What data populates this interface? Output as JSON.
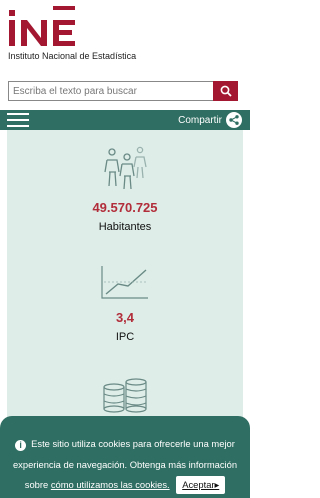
{
  "header": {
    "logo_text": "Instituto Nacional de Estadística",
    "brand_color": "#a31830"
  },
  "search": {
    "placeholder": "Escriba el texto para buscar",
    "icon": "search-icon"
  },
  "nav": {
    "menu_icon": "hamburger-icon",
    "share_label": "Compartir",
    "share_icon": "share-icon",
    "bar_color": "#2f6e62"
  },
  "stats": [
    {
      "icon": "people-icon",
      "value": "49.570.725",
      "label": "Habitantes"
    },
    {
      "icon": "line-chart-icon",
      "value": "3,4",
      "label": "IPC"
    },
    {
      "icon": "coins-icon"
    }
  ],
  "cookie": {
    "line1": "Este sitio utiliza cookies para ofrecerle una mejor",
    "line2": "experiencia de navegación. Obtenga más información",
    "line3_prefix": "sobre",
    "link_label": "cómo utilizamos las cookies.",
    "accept_label": "Aceptar",
    "icon": "info-icon"
  }
}
